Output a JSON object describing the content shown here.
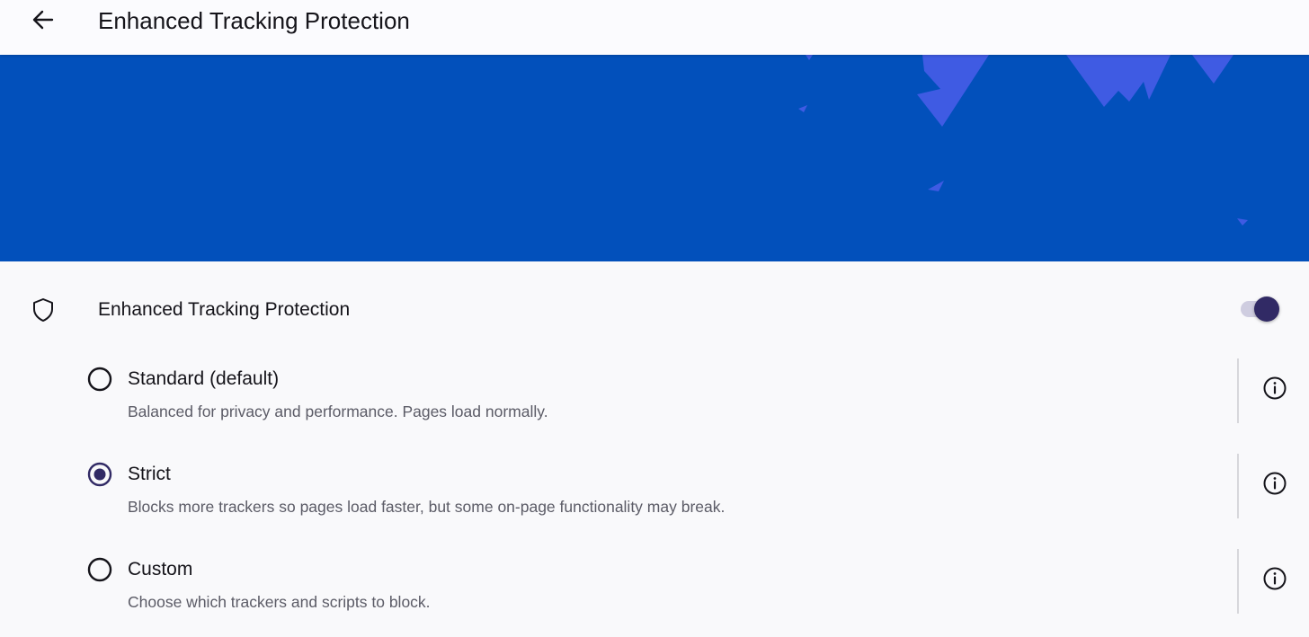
{
  "header": {
    "back_icon": "arrow-left-icon",
    "title": "Enhanced Tracking Protection"
  },
  "banner": {
    "background_color": "#0250bb",
    "accent_color": "#3f5be3"
  },
  "etp_setting": {
    "icon": "shield-icon",
    "label": "Enhanced Tracking Protection",
    "toggle_on": true,
    "toggle_color": "#312a65"
  },
  "options": [
    {
      "title": "Standard (default)",
      "description": "Balanced for privacy and performance. Pages load normally.",
      "selected": false,
      "info_icon": "info-icon"
    },
    {
      "title": "Strict",
      "description": "Blocks more trackers so pages load faster, but some on-page functionality may break.",
      "selected": true,
      "info_icon": "info-icon"
    },
    {
      "title": "Custom",
      "description": "Choose which trackers and scripts to block.",
      "selected": false,
      "info_icon": "info-icon"
    }
  ]
}
